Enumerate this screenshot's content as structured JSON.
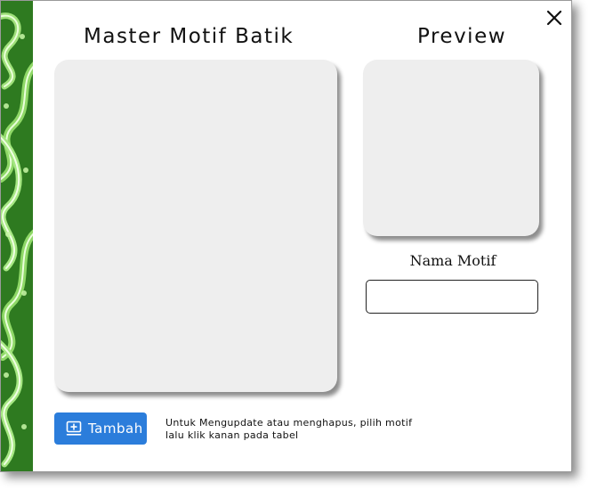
{
  "window": {
    "title_left": "Master Motif Batik",
    "title_right": "Preview"
  },
  "form": {
    "name_label": "Nama Motif",
    "name_value": "",
    "name_placeholder": ""
  },
  "actions": {
    "add_label": "Tambah",
    "add_icon": "add-box-icon",
    "close_icon": "close-icon"
  },
  "hint": {
    "line1": "Untuk Mengupdate atau menghapus, pilih motif",
    "line2": "lalu klik kanan pada tabel"
  },
  "colors": {
    "accent": "#2b7ddb",
    "panel": "#eeeeee",
    "batik_green": "#2f7d22"
  }
}
